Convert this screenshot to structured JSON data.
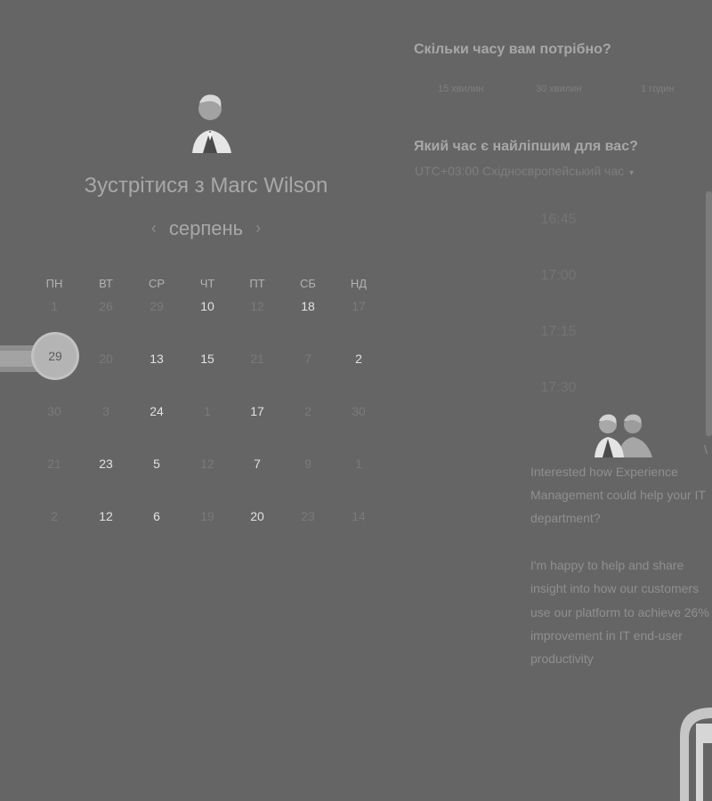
{
  "title_prefix": "Зустрітися з",
  "host_name": "Marc Wilson",
  "calendar": {
    "month": "серпень",
    "prev_icon": "‹",
    "next_icon": "›",
    "weekdays": [
      "ПН",
      "ВТ",
      "СР",
      "ЧТ",
      "ПТ",
      "СБ",
      "НД"
    ],
    "weeks": [
      [
        "1",
        "26",
        "29",
        "10",
        "12",
        "18",
        "17"
      ],
      [
        "29",
        "20",
        "13",
        "15",
        "21",
        "7",
        "2"
      ],
      [
        "30",
        "3",
        "24",
        "1",
        "17",
        "2",
        "30"
      ],
      [
        "21",
        "23",
        "5",
        "12",
        "7",
        "9",
        "1"
      ],
      [
        "2",
        "12",
        "6",
        "19",
        "20",
        "23",
        "14"
      ]
    ],
    "available": [
      [
        false,
        false,
        false,
        true,
        false,
        true,
        false
      ],
      [
        true,
        false,
        true,
        true,
        false,
        false,
        true
      ],
      [
        false,
        false,
        true,
        false,
        true,
        false,
        false
      ],
      [
        false,
        true,
        true,
        false,
        true,
        false,
        false
      ],
      [
        false,
        true,
        true,
        false,
        true,
        false,
        false
      ]
    ],
    "selected_day": "29"
  },
  "duration": {
    "heading": "Скільки часу вам потрібно?",
    "options": [
      "15 хвилин",
      "30 хвилин",
      "1 годин"
    ]
  },
  "timeslots": {
    "heading": "Який час є найліпшим для вас?",
    "timezone": "UTC+03:00 Східноєвропейський час",
    "caret_icon": "▾",
    "slots": [
      "16:45",
      "17:00",
      "17:15",
      "17:30"
    ]
  },
  "message": {
    "line1_before": "Interested how",
    "line1_after": "Experience",
    "line2": "Management could help your IT",
    "line3": "department?",
    "line4": "I'm happy to help and share",
    "line5": "insight into how our customers",
    "line6": "use our platform to achieve 26%",
    "line7": "improvement in IT end-user",
    "line8": "productivity"
  },
  "edge_glyph": "\\"
}
